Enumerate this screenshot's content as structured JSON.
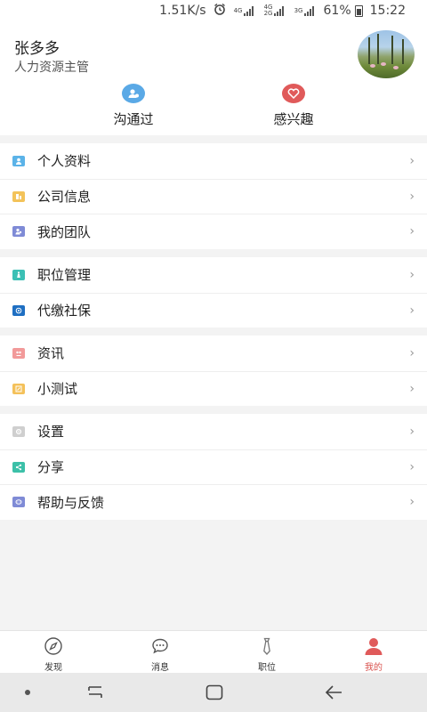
{
  "status_bar": {
    "speed": "1.51K/s",
    "net1_top": "4G",
    "net1_bottom": "",
    "net2_top": "4G",
    "net2_bottom": "2G",
    "net3_top": "3G",
    "battery": "61%",
    "time": "15:22",
    "icons": [
      "alarm-icon",
      "signal-icon",
      "battery-icon"
    ]
  },
  "profile": {
    "name": "张多多",
    "title": "人力资源主管",
    "quick_actions": [
      {
        "label": "沟通过",
        "icon": "contact-person-icon",
        "color": "#5aa9e6"
      },
      {
        "label": "感兴趣",
        "icon": "heart-icon",
        "color": "#e05a5a"
      }
    ]
  },
  "menu_groups": [
    [
      {
        "label": "个人资料",
        "icon": "profile-icon",
        "color": "#5bb3e8"
      },
      {
        "label": "公司信息",
        "icon": "company-icon",
        "color": "#f3c35a"
      },
      {
        "label": "我的团队",
        "icon": "team-icon",
        "color": "#7f8bd6"
      }
    ],
    [
      {
        "label": "职位管理",
        "icon": "position-icon",
        "color": "#3cc0b5"
      },
      {
        "label": "代缴社保",
        "icon": "insurance-icon",
        "color": "#1f6fc2"
      }
    ],
    [
      {
        "label": "资讯",
        "icon": "news-icon",
        "color": "#f29a9a"
      },
      {
        "label": "小测试",
        "icon": "quiz-icon",
        "color": "#f4c15a"
      }
    ],
    [
      {
        "label": "设置",
        "icon": "settings-icon",
        "color": "#cfcfcf"
      },
      {
        "label": "分享",
        "icon": "share-icon",
        "color": "#3cc0a8"
      },
      {
        "label": "帮助与反馈",
        "icon": "help-icon",
        "color": "#7f8bd6"
      }
    ]
  ],
  "bottom_nav": [
    {
      "label": "发现",
      "icon": "compass-icon",
      "active": false
    },
    {
      "label": "消息",
      "icon": "chat-icon",
      "active": false
    },
    {
      "label": "职位",
      "icon": "tie-icon",
      "active": false
    },
    {
      "label": "我的",
      "icon": "user-icon",
      "active": true
    }
  ],
  "accent_color": "#d9534f"
}
